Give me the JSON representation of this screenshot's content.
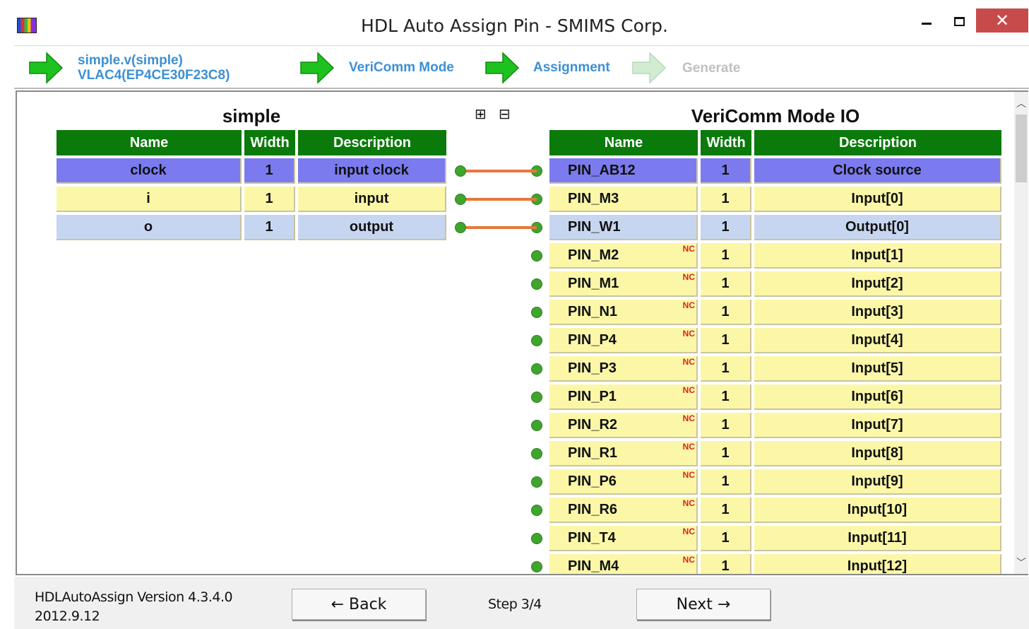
{
  "window": {
    "title": "HDL Auto Assign Pin - SMIMS Corp.",
    "close_glyph": "✕"
  },
  "steps": [
    {
      "line1": "simple.v(simple)",
      "line2": "VLAC4(EP4CE30F23C8)",
      "state": "done"
    },
    {
      "label": "VeriComm Mode",
      "state": "done"
    },
    {
      "label": "Assignment",
      "state": "current"
    },
    {
      "label": "Generate",
      "state": "disabled"
    }
  ],
  "left_table": {
    "title": "simple",
    "headers": [
      "Name",
      "Width",
      "Description"
    ],
    "rows": [
      {
        "name": "clock",
        "width": "1",
        "description": "input clock",
        "color": "#7b7bef"
      },
      {
        "name": "i",
        "width": "1",
        "description": "input",
        "color": "#fbf7a7"
      },
      {
        "name": "o",
        "width": "1",
        "description": "output",
        "color": "#c7d6f0"
      }
    ]
  },
  "right_table": {
    "title": "VeriComm Mode IO",
    "headers": [
      "Name",
      "Width",
      "Description"
    ],
    "nc_label": "NC",
    "rows": [
      {
        "name": "PIN_AB12",
        "width": "1",
        "description": "Clock source",
        "nc": false,
        "color": "#7b7bef"
      },
      {
        "name": "PIN_M3",
        "width": "1",
        "description": "Input[0]",
        "nc": false,
        "color": "#fbf7a7"
      },
      {
        "name": "PIN_W1",
        "width": "1",
        "description": "Output[0]",
        "nc": false,
        "color": "#c7d6f0"
      },
      {
        "name": "PIN_M2",
        "width": "1",
        "description": "Input[1]",
        "nc": true,
        "color": "#fbf7a7"
      },
      {
        "name": "PIN_M1",
        "width": "1",
        "description": "Input[2]",
        "nc": true,
        "color": "#fbf7a7"
      },
      {
        "name": "PIN_N1",
        "width": "1",
        "description": "Input[3]",
        "nc": true,
        "color": "#fbf7a7"
      },
      {
        "name": "PIN_P4",
        "width": "1",
        "description": "Input[4]",
        "nc": true,
        "color": "#fbf7a7"
      },
      {
        "name": "PIN_P3",
        "width": "1",
        "description": "Input[5]",
        "nc": true,
        "color": "#fbf7a7"
      },
      {
        "name": "PIN_P1",
        "width": "1",
        "description": "Input[6]",
        "nc": true,
        "color": "#fbf7a7"
      },
      {
        "name": "PIN_R2",
        "width": "1",
        "description": "Input[7]",
        "nc": true,
        "color": "#fbf7a7"
      },
      {
        "name": "PIN_R1",
        "width": "1",
        "description": "Input[8]",
        "nc": true,
        "color": "#fbf7a7"
      },
      {
        "name": "PIN_P6",
        "width": "1",
        "description": "Input[9]",
        "nc": true,
        "color": "#fbf7a7"
      },
      {
        "name": "PIN_R6",
        "width": "1",
        "description": "Input[10]",
        "nc": true,
        "color": "#fbf7a7"
      },
      {
        "name": "PIN_T4",
        "width": "1",
        "description": "Input[11]",
        "nc": true,
        "color": "#fbf7a7"
      },
      {
        "name": "PIN_M4",
        "width": "1",
        "description": "Input[12]",
        "nc": true,
        "color": "#fbf7a7"
      }
    ]
  },
  "connections": [
    [
      0,
      0
    ],
    [
      1,
      1
    ],
    [
      2,
      2
    ]
  ],
  "footer": {
    "version": "HDLAutoAssign Version 4.3.4.0",
    "date": "2012.9.12",
    "back_label": "← Back",
    "step_text": "Step 3/4",
    "next_label": "Next →"
  },
  "colors": {
    "header_green": "#0a7a0a",
    "step_blue": "#3d8fd4",
    "connector_green": "#3fa52c",
    "wire_orange": "#e8773a",
    "nc_red": "#e02020"
  }
}
